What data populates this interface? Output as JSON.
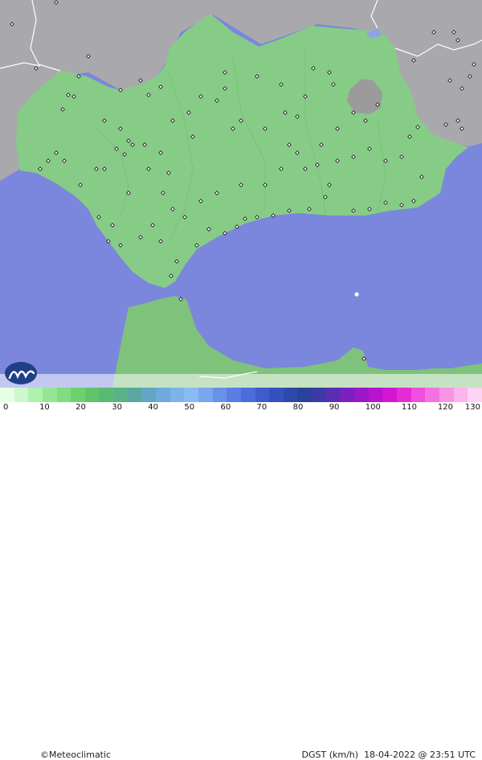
{
  "map": {
    "brand_symbol": "©",
    "brand_name": "Meteoclimatic",
    "variable": "DGST (km/h)",
    "timestamp": "18-04-2022 @ 23:51 UTC",
    "colors": {
      "sea": "#7b86dd",
      "land_outside": "#a9a9ad",
      "region_fill": "#86cc86",
      "highland": "#9b9b9b",
      "north_africa": "#7fc27c"
    },
    "icons": [
      "meteoclimatic-logo-icon",
      "station-marker-icon",
      "lake-icon"
    ]
  },
  "legend": {
    "ticks": [
      "0",
      "10",
      "20",
      "30",
      "40",
      "50",
      "60",
      "70",
      "80",
      "90",
      "100",
      "110",
      "120",
      "130"
    ],
    "colors": [
      "#e6fde6",
      "#cdf7cd",
      "#aef0ae",
      "#94e694",
      "#7fdc80",
      "#6bd26e",
      "#5ec669",
      "#58bb72",
      "#5ab388",
      "#5aa89e",
      "#62a6c3",
      "#6fa9de",
      "#7db2ec",
      "#89baf1",
      "#7aa6ee",
      "#6a91e9",
      "#5a7ee3",
      "#4b6cd9",
      "#3f5ccc",
      "#3551bd",
      "#2e49ac",
      "#2a439a",
      "#3b3aa6",
      "#5a2eb3",
      "#7a22bf",
      "#9a18c8",
      "#b814cf",
      "#d316d3",
      "#e42bd6",
      "#ee4fdc",
      "#f472e1",
      "#f894e6",
      "#fbb4ec",
      "#fdd2f3"
    ]
  }
}
